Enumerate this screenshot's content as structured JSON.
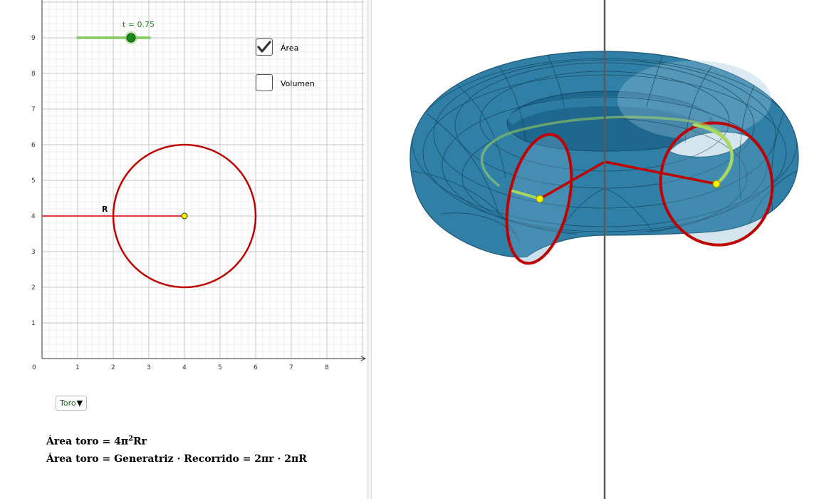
{
  "slider": {
    "label": "t = 0.75",
    "value": 0.75
  },
  "checkboxes": [
    {
      "label": "Área",
      "checked": true
    },
    {
      "label": "Volumen",
      "checked": false
    }
  ],
  "axes": {
    "x_ticks": [
      "0",
      "1",
      "2",
      "3",
      "4",
      "5",
      "6",
      "7",
      "8"
    ],
    "y_ticks": [
      "1",
      "2",
      "3",
      "4",
      "5",
      "6",
      "7",
      "8",
      "9"
    ]
  },
  "construction": {
    "circle_center": [
      4,
      4
    ],
    "circle_radius": 2,
    "segment_from": [
      0,
      4
    ],
    "segment_to": [
      4,
      4
    ],
    "segment_label": "R"
  },
  "dropdown": {
    "selected": "Toro"
  },
  "formulas": {
    "line1_prefix": "Área toro = 4π",
    "line1_sup": "2",
    "line1_suffix": "Rr",
    "line2": "Área toro =  Generatriz ·  Recorrido = 2πr · 2πR"
  },
  "colors": {
    "circle": "#c00000",
    "segment": "#e03a3a",
    "slider": "#1a8a1a",
    "slider_track": "#8fcf6f",
    "torus": "#2f7fa6",
    "path": "#a8d860",
    "point": "#f5f000"
  }
}
